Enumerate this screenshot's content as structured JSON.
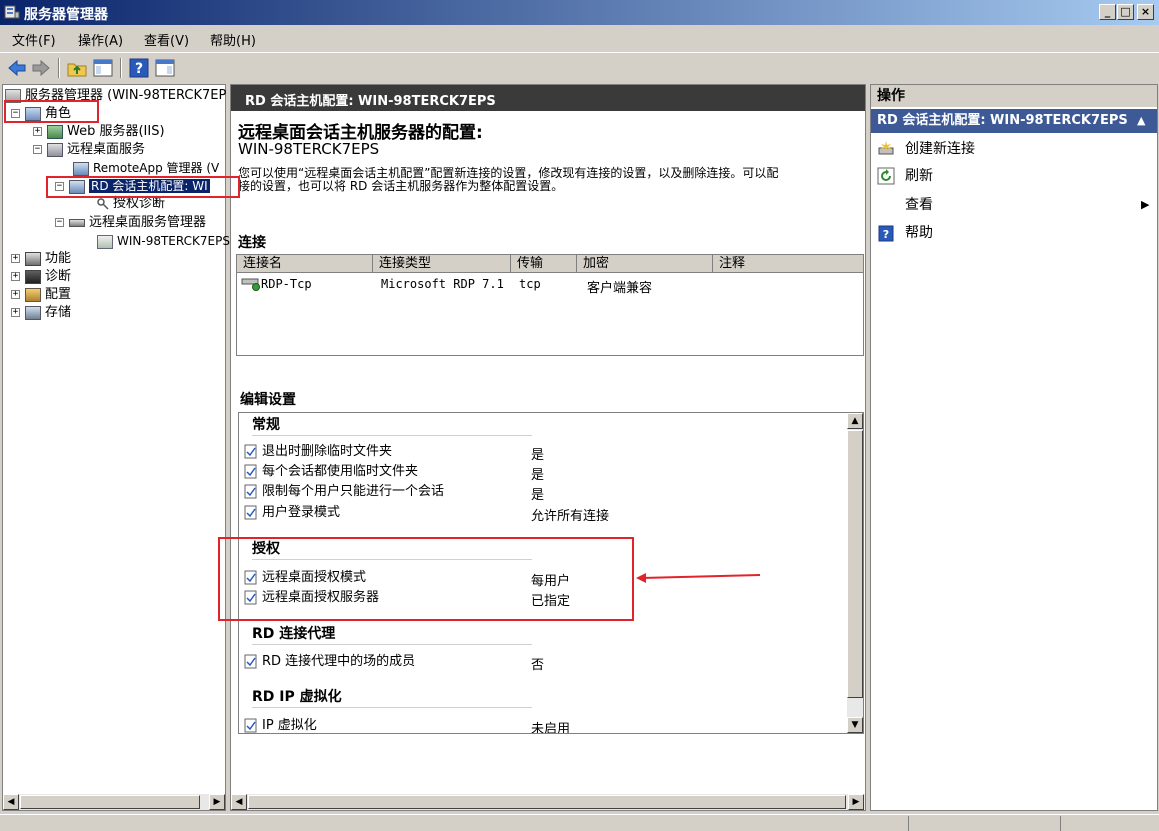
{
  "window": {
    "title": "服务器管理器",
    "controls": [
      "_",
      "□",
      "×"
    ]
  },
  "menu": [
    "文件(F)",
    "操作(A)",
    "查看(V)",
    "帮助(H)"
  ],
  "tree": {
    "root": "服务器管理器 (WIN-98TERCK7EP",
    "roles": "角色",
    "web": "Web 服务器(IIS)",
    "rds": "远程桌面服务",
    "remoteapp": "RemoteApp 管理器 (V",
    "rdsh_config": "RD 会话主机配置: WI",
    "lic_diag": "授权诊断",
    "rds_mgr": "远程桌面服务管理器",
    "server": "WIN-98TERCK7EPS",
    "features": "功能",
    "diagnostics": "诊断",
    "config": "配置",
    "storage": "存储"
  },
  "middle": {
    "header": "RD 会话主机配置: WIN-98TERCK7EPS",
    "title": "远程桌面会话主机服务器的配置:",
    "server": "WIN-98TERCK7EPS",
    "desc1": "您可以使用“远程桌面会话主机配置”配置新连接的设置，修改现有连接的设置，以及删除连接。可以配",
    "desc2": "接的设置，也可以将 RD 会话主机服务器作为整体配置设置。",
    "connections_title": "连接",
    "columns": [
      "连接名",
      "连接类型",
      "传输",
      "加密",
      "注释"
    ],
    "connection": {
      "name": "RDP-Tcp",
      "type": "Microsoft RDP 7.1",
      "transport": "tcp",
      "encryption": "客户端兼容",
      "comment": ""
    },
    "edit_title": "编辑设置",
    "groups": {
      "general": {
        "title": "常规",
        "rows": [
          {
            "label": "退出时删除临时文件夹",
            "value": "是"
          },
          {
            "label": "每个会话都使用临时文件夹",
            "value": "是"
          },
          {
            "label": "限制每个用户只能进行一个会话",
            "value": "是"
          },
          {
            "label": "用户登录模式",
            "value": "允许所有连接"
          }
        ]
      },
      "licensing": {
        "title": "授权",
        "rows": [
          {
            "label": "远程桌面授权模式",
            "value": "每用户"
          },
          {
            "label": "远程桌面授权服务器",
            "value": "已指定"
          }
        ]
      },
      "broker": {
        "title": "RD 连接代理",
        "rows": [
          {
            "label": "RD 连接代理中的场的成员",
            "value": "否"
          }
        ]
      },
      "ipvirt": {
        "title": "RD IP 虚拟化",
        "rows": [
          {
            "label": "IP 虚拟化",
            "value": "未启用"
          }
        ]
      }
    }
  },
  "right": {
    "title": "操作",
    "subheader": "RD 会话主机配置: WIN-98TERCK7EPS",
    "actions": [
      "创建新连接",
      "刷新",
      "查看",
      "帮助"
    ]
  },
  "colors": {
    "titlebar": "#0a246a",
    "annotation": "#e0242c",
    "selection": "#0a246a",
    "action_header": "#3d5a96"
  }
}
